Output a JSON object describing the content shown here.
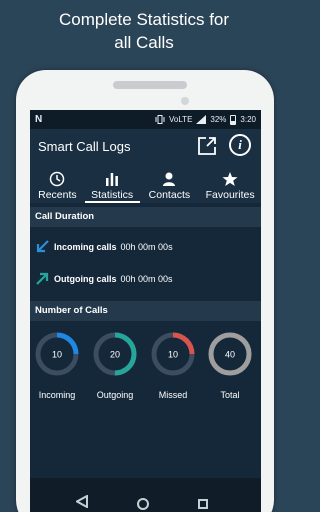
{
  "promo": {
    "title_line1": "Complete Statistics for",
    "title_line2": "all Calls"
  },
  "status_bar": {
    "carrier_icon": "N",
    "network": "VoLTE",
    "battery": "32%",
    "time": "3:20"
  },
  "app": {
    "title": "Smart Call Logs",
    "share_icon": "share-icon",
    "info_icon": "info-icon",
    "info_glyph": "i"
  },
  "tabs": [
    {
      "label": "Recents",
      "icon": "clock-icon",
      "active": false
    },
    {
      "label": "Statistics",
      "icon": "bar-chart-icon",
      "active": true
    },
    {
      "label": "Contacts",
      "icon": "person-icon",
      "active": false
    },
    {
      "label": "Favourites",
      "icon": "star-icon",
      "active": false
    }
  ],
  "call_duration": {
    "heading": "Call Duration",
    "incoming": {
      "label": "Incoming calls",
      "value": "00h 00m 00s",
      "icon": "incoming-arrow-icon"
    },
    "outgoing": {
      "label": "Outgoing calls",
      "value": "00h 00m 00s",
      "icon": "outgoing-arrow-icon"
    }
  },
  "number_of_calls": {
    "heading": "Number of Calls",
    "items": [
      {
        "label": "Incoming",
        "count": "10",
        "fraction": 0.25,
        "color": "#1e88e5"
      },
      {
        "label": "Outgoing",
        "count": "20",
        "fraction": 0.5,
        "color": "#26a69a"
      },
      {
        "label": "Missed",
        "count": "10",
        "fraction": 0.25,
        "color": "#d9534f"
      },
      {
        "label": "Total",
        "count": "40",
        "fraction": 1.0,
        "color": "#9e9e9e"
      }
    ]
  },
  "colors": {
    "screen_bg": "#15283a",
    "page_bg": "#2b4558"
  }
}
